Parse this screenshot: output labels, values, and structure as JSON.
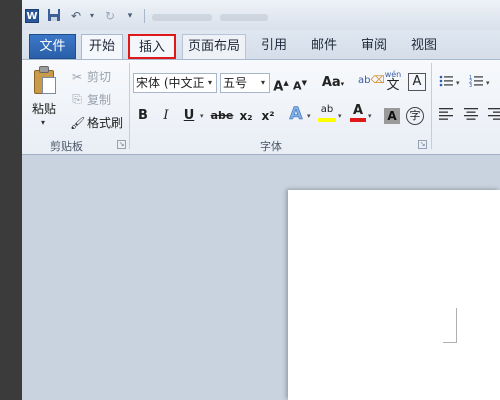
{
  "tabs": [
    {
      "label": "文件"
    },
    {
      "label": "开始"
    },
    {
      "label": "插入"
    },
    {
      "label": "页面布局"
    },
    {
      "label": "引用"
    },
    {
      "label": "邮件"
    },
    {
      "label": "审阅"
    },
    {
      "label": "视图"
    }
  ],
  "clipboard": {
    "paste": "粘贴",
    "cut": "剪切",
    "copy": "复制",
    "format_painter": "格式刷",
    "group_label": "剪贴板"
  },
  "font": {
    "font_name": "宋体 (中文正文",
    "font_size": "五号",
    "grow": "A",
    "shrink": "A",
    "change_case": "Aa",
    "clear_format": "ab",
    "phonetic_top": "wén",
    "phonetic": "文",
    "char_border": "A",
    "bold": "B",
    "italic": "I",
    "underline": "U",
    "strike": "abe",
    "subscript": "x₂",
    "superscript": "x²",
    "text_effect": "A",
    "highlight": "ab",
    "font_color": "A",
    "char_shading": "A",
    "enclose": "字",
    "group_label": "字体"
  },
  "colors": {
    "highlight_tab_border": "#e01818",
    "file_tab_bg": "#2a5fa9",
    "font_color_bar": "#e01818",
    "highlight_bar": "#ffff00"
  }
}
